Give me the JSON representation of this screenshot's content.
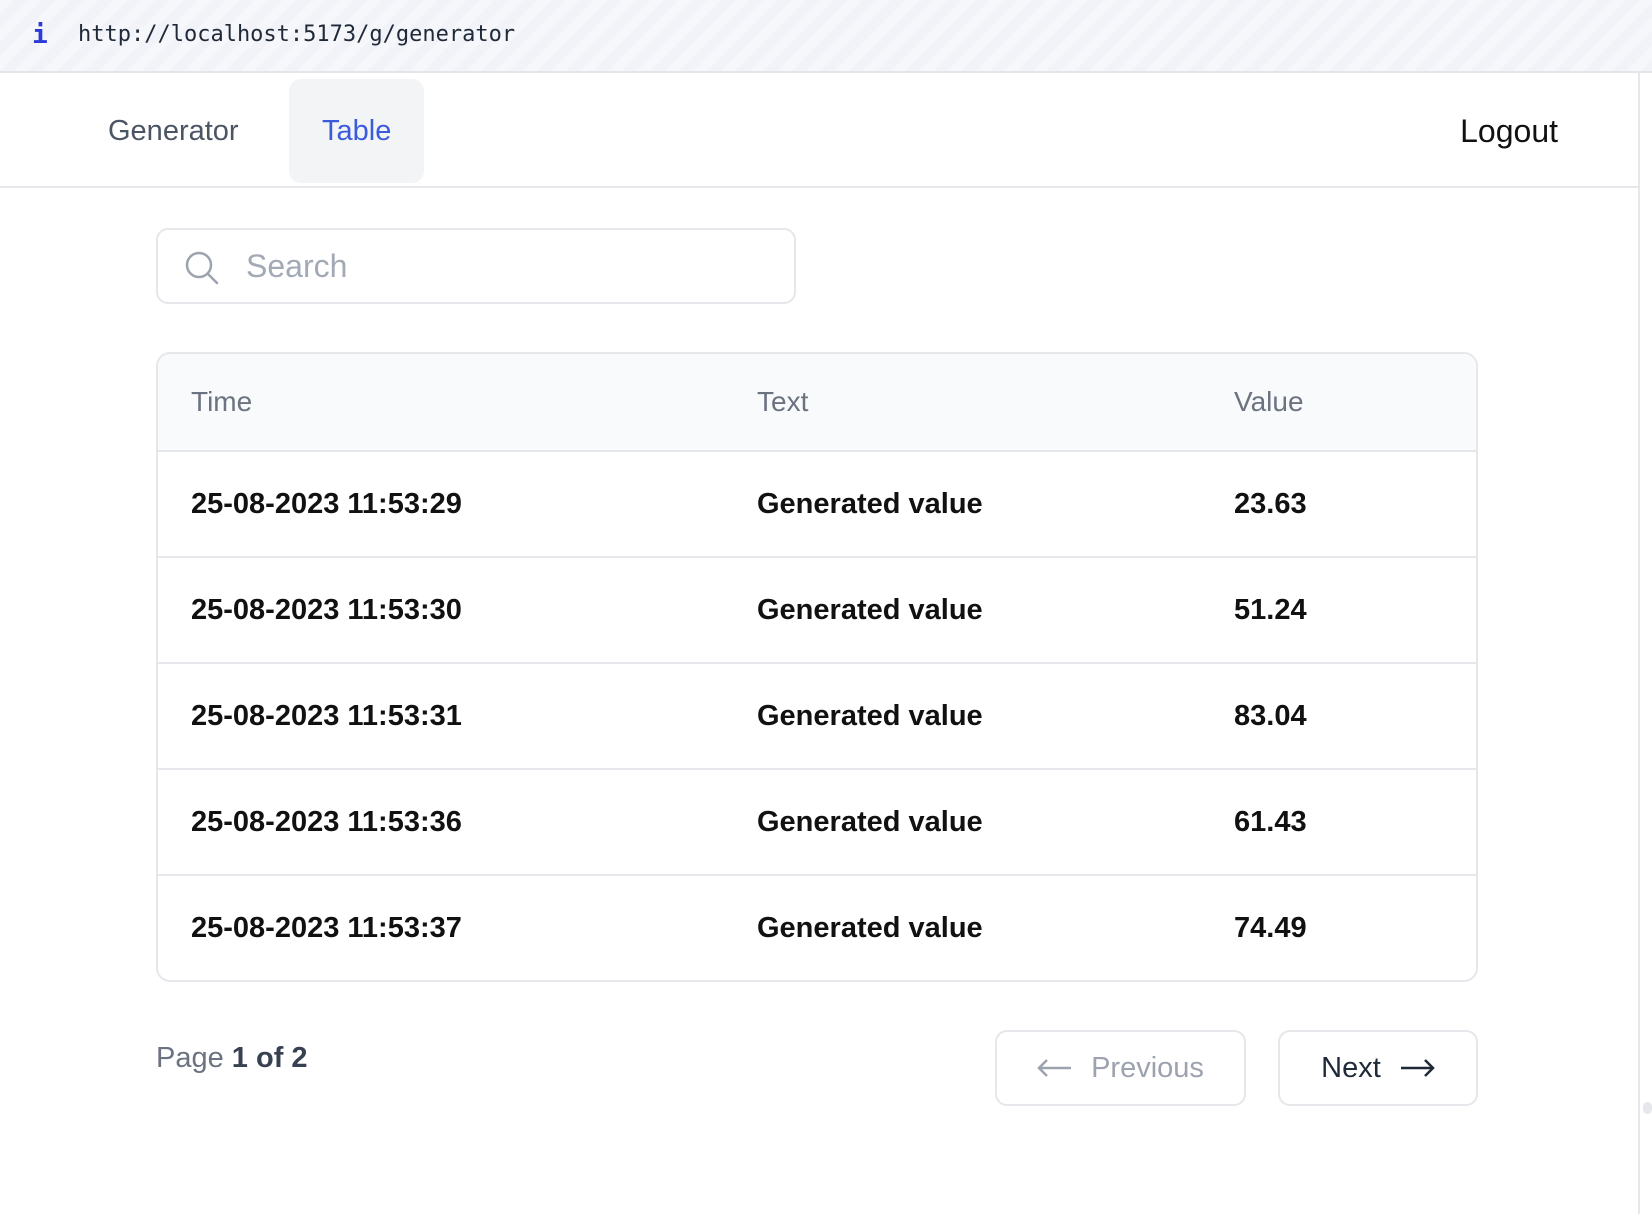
{
  "browser": {
    "info_label": "i",
    "url": "http://localhost:5173/g/generator"
  },
  "nav": {
    "tabs": [
      {
        "label": "Generator",
        "active": false
      },
      {
        "label": "Table",
        "active": true
      }
    ],
    "logout_label": "Logout"
  },
  "search": {
    "value": "",
    "placeholder": "Search"
  },
  "table": {
    "columns": [
      "Time",
      "Text",
      "Value"
    ],
    "rows": [
      [
        "25-08-2023 11:53:29",
        "Generated value",
        "23.63"
      ],
      [
        "25-08-2023 11:53:30",
        "Generated value",
        "51.24"
      ],
      [
        "25-08-2023 11:53:31",
        "Generated value",
        "83.04"
      ],
      [
        "25-08-2023 11:53:36",
        "Generated value",
        "61.43"
      ],
      [
        "25-08-2023 11:53:37",
        "Generated value",
        "74.49"
      ]
    ]
  },
  "pagination": {
    "page_word": "Page",
    "current_of_total": "1 of 2",
    "previous_label": "Previous",
    "next_label": "Next"
  },
  "colors": {
    "accent": "#3b5bdb",
    "active_tab_bg": "#f3f4f6",
    "border": "#e5e7eb"
  },
  "icons": {
    "search": "search-icon",
    "previous": "arrow-left-icon",
    "next": "arrow-right-icon"
  }
}
